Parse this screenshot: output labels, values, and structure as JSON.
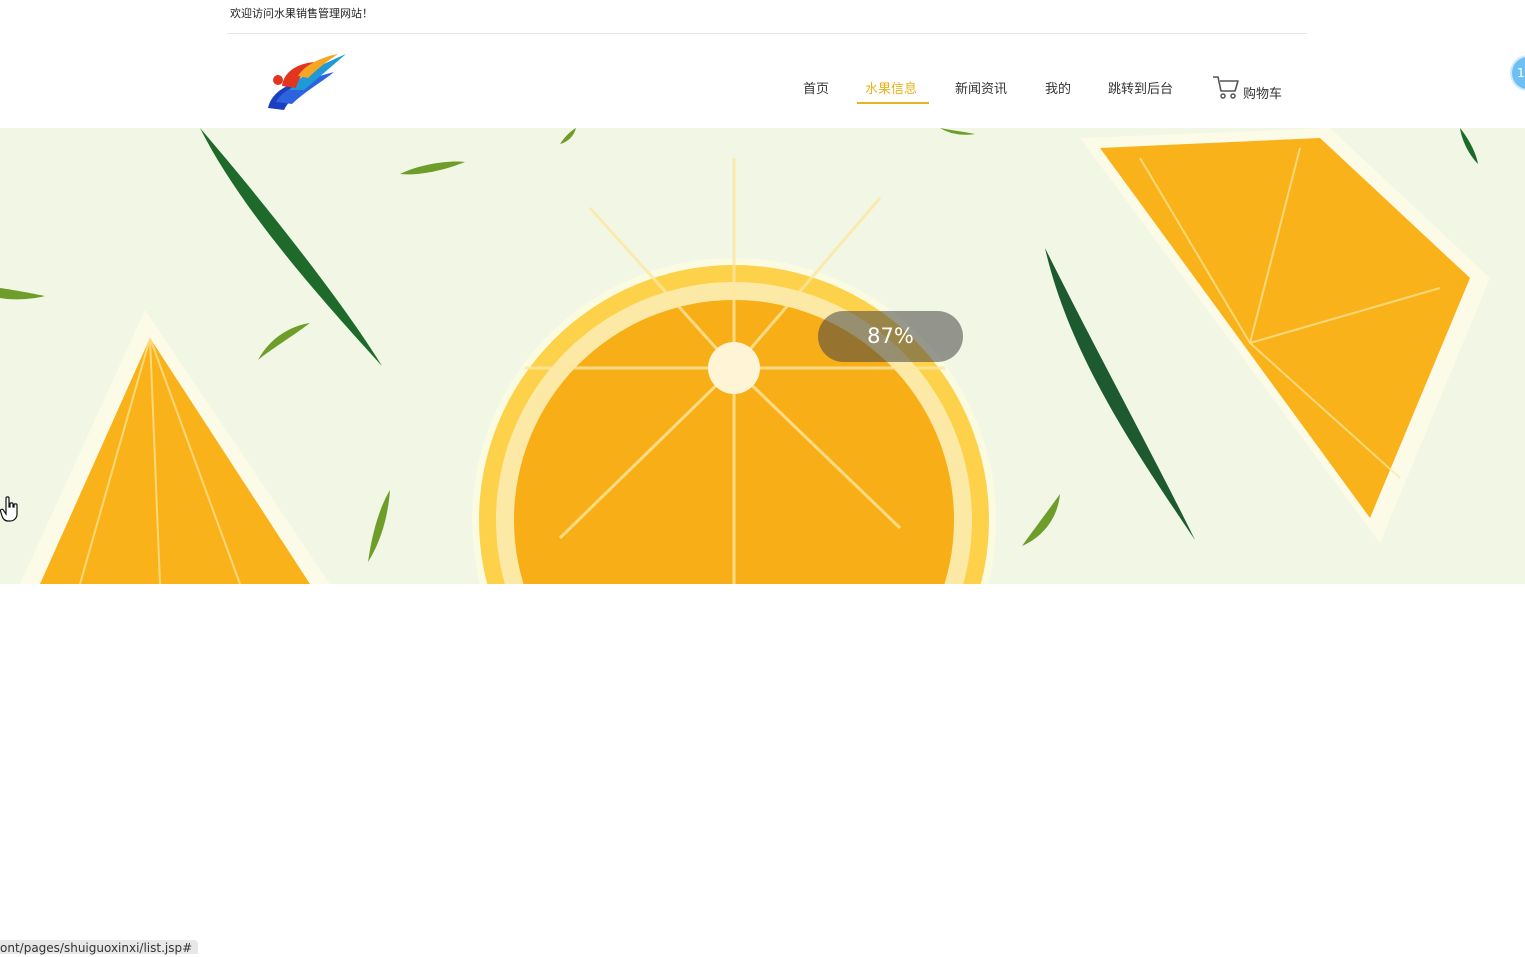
{
  "welcome_text": "欢迎访问水果销售管理网站！",
  "nav": {
    "items": [
      {
        "label": "首页"
      },
      {
        "label": "水果信息",
        "active": true
      },
      {
        "label": "新闻资讯"
      },
      {
        "label": "我的"
      },
      {
        "label": "跳转到后台"
      }
    ],
    "cart_label": "购物车",
    "active_color": "#e8b31c"
  },
  "side_badge": "1(",
  "banner": {
    "loading_text": "87%",
    "loading_progress_percent": 87
  },
  "status_bar": {
    "url": "ont/pages/shuiguoxinxi/list.jsp#"
  },
  "icons": [
    "logo-icon",
    "cart-icon",
    "hand-cursor-icon"
  ]
}
